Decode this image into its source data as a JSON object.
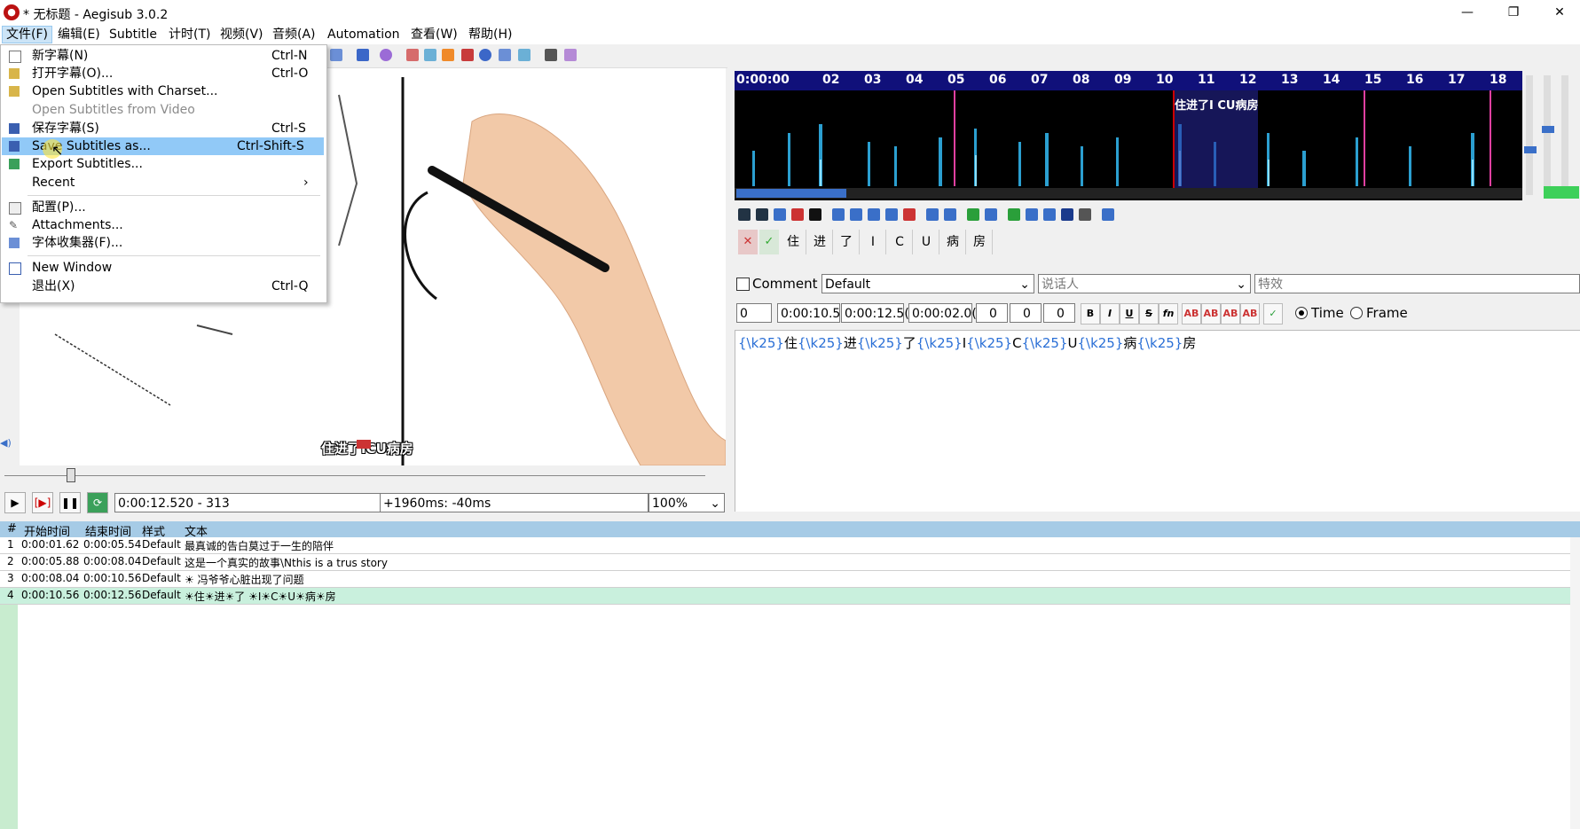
{
  "window": {
    "title": "* 无标题 - Aegisub 3.0.2",
    "minimize": "—",
    "maximize": "❐",
    "close": "✕"
  },
  "menubar": [
    "文件(F)",
    "编辑(E)",
    "Subtitle",
    "计时(T)",
    "视频(V)",
    "音频(A)",
    "Automation",
    "查看(W)",
    "帮助(H)"
  ],
  "file_menu": {
    "items": [
      {
        "label": "新字幕(N)",
        "accel": "Ctrl-N"
      },
      {
        "label": "打开字幕(O)...",
        "accel": "Ctrl-O"
      },
      {
        "label": "Open Subtitles with Charset...",
        "accel": ""
      },
      {
        "label": "Open Subtitles from Video",
        "accel": ""
      },
      {
        "label": "保存字幕(S)",
        "accel": "Ctrl-S"
      },
      {
        "label": "Save Subtitles as...",
        "accel": "Ctrl-Shift-S"
      },
      {
        "label": "Export Subtitles...",
        "accel": ""
      },
      {
        "label": "Recent",
        "accel": "›"
      },
      {
        "label": "配置(P)...",
        "accel": ""
      },
      {
        "label": "Attachments...",
        "accel": ""
      },
      {
        "label": "字体收集器(F)...",
        "accel": ""
      },
      {
        "label": "New Window",
        "accel": ""
      },
      {
        "label": "退出(X)",
        "accel": "Ctrl-Q"
      }
    ]
  },
  "video": {
    "subtitle": "住进了ICU病房",
    "time": "0:00:12.520 - 313",
    "offset": "+1960ms: -40ms",
    "zoom": "100%"
  },
  "audio": {
    "ruler": [
      "0:00:00",
      "02",
      "03",
      "04",
      "05",
      "06",
      "07",
      "08",
      "09",
      "10",
      "11",
      "12",
      "13",
      "14",
      "15",
      "16",
      "17",
      "18"
    ],
    "caption": "住进了I CU病房"
  },
  "karaoke": [
    "住",
    "进",
    "了",
    "I",
    "C",
    "U",
    "病",
    "房"
  ],
  "edit": {
    "comment_label": "Comment",
    "style": "Default",
    "actor_placeholder": "说话人",
    "effect_placeholder": "特效",
    "layer": "0",
    "start": "0:00:10.5(",
    "end": "0:00:12.5(",
    "duration": "0:00:02.0(",
    "margin_l": "0",
    "margin_r": "0",
    "margin_v": "0",
    "time_label": "Time",
    "frame_label": "Frame",
    "text_parts": [
      "{\\k25}",
      "住",
      "{\\k25}",
      "进",
      "{\\k25}",
      "了",
      "{\\k25}",
      "I",
      "{\\k25}",
      "C",
      "{\\k25}",
      "U",
      "{\\k25}",
      "病",
      "{\\k25}",
      "房"
    ]
  },
  "grid": {
    "headers": [
      "#",
      "开始时间",
      "结束时间",
      "样式",
      "文本"
    ],
    "rows": [
      {
        "n": "1",
        "start": "0:00:01.62",
        "end": "0:00:05.54",
        "style": "Default",
        "text": "最真诚的告白莫过于一生的陪伴"
      },
      {
        "n": "2",
        "start": "0:00:05.88",
        "end": "0:00:08.04",
        "style": "Default",
        "text": "这是一个真实的故事\\Nthis is a trus story"
      },
      {
        "n": "3",
        "start": "0:00:08.04",
        "end": "0:00:10.56",
        "style": "Default",
        "text": "☀ 冯爷爷心脏出现了问题"
      },
      {
        "n": "4",
        "start": "0:00:10.56",
        "end": "0:00:12.56",
        "style": "Default",
        "text": "☀住☀进☀了 ☀I☀C☀U☀病☀房"
      }
    ]
  },
  "colors": {
    "menu_highlight": "#91c9f7",
    "grid_header": "#a6cbe6",
    "grid_selected": "#c9f0dd",
    "tag_blue": "#2a6fd6"
  }
}
